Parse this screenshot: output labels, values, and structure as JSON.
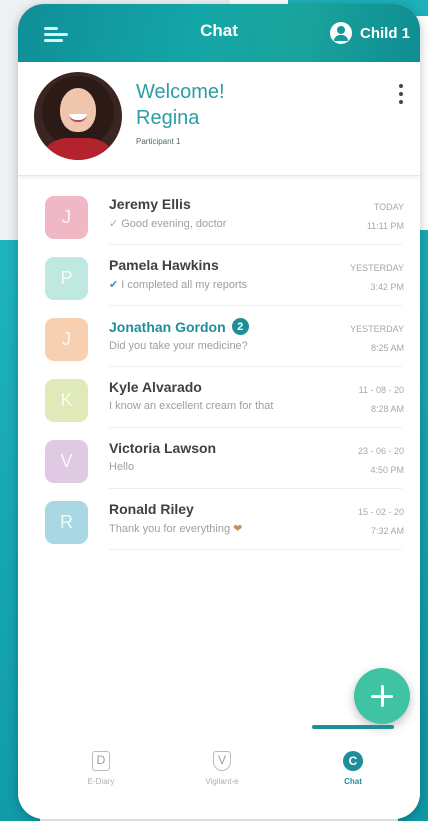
{
  "app_bar": {
    "title": "Chat",
    "account_label": "Child 1"
  },
  "profile": {
    "welcome": "Welcome!",
    "name": "Regina",
    "participant": "Participant 1"
  },
  "chats": [
    {
      "initial": "J",
      "name": "Jeremy Ellis",
      "preview": "Good evening, doctor",
      "check": "✓",
      "check_color": "grey",
      "date": "TODAY",
      "time": "11:11 PM",
      "badge": "",
      "avatar_color": "#f0b8c4"
    },
    {
      "initial": "P",
      "name": "Pamela Hawkins",
      "preview": "I completed all my reports",
      "check": "✔",
      "check_color": "blue",
      "date": "YESTERDAY",
      "time": "3:42 PM",
      "badge": "",
      "avatar_color": "#bfe8e1"
    },
    {
      "initial": "J",
      "name": "Jonathan Gordon",
      "preview": "Did you take your medicine?",
      "check": "",
      "check_color": "",
      "date": "YESTERDAY",
      "time": "8:25 AM",
      "badge": "2",
      "avatar_color": "#f7d0b2"
    },
    {
      "initial": "K",
      "name": "Kyle Alvarado",
      "preview": "I know an excellent cream for that",
      "check": "",
      "check_color": "",
      "date": "11 - 08 - 20",
      "time": "8:28 AM",
      "badge": "",
      "avatar_color": "#dfeab8"
    },
    {
      "initial": "V",
      "name": "Victoria Lawson",
      "preview": "Hello",
      "check": "",
      "check_color": "",
      "date": "23 - 06 - 20",
      "time": "4:50 PM",
      "badge": "",
      "avatar_color": "#e0c9e3"
    },
    {
      "initial": "R",
      "name": "Ronald Riley",
      "preview": "Thank you for everything",
      "check": "",
      "check_color": "",
      "date": "15 - 02 - 20",
      "time": "7:32 AM",
      "badge": "",
      "avatar_color": "#a9d8e4",
      "emoji": "❤"
    }
  ],
  "bottom_nav": [
    {
      "letter": "D",
      "label": "E-Diary",
      "active": false
    },
    {
      "letter": "V",
      "label": "Vigilant-e",
      "active": false
    },
    {
      "letter": "C",
      "label": "Chat",
      "active": true
    }
  ],
  "colors": {
    "brand_teal": "#1f8e98",
    "fab": "#3fc3a3"
  },
  "icons": {
    "menu": "hamburger-menu-icon",
    "account": "user-circle-icon",
    "more": "more-vertical-icon",
    "fab": "plus-icon"
  }
}
